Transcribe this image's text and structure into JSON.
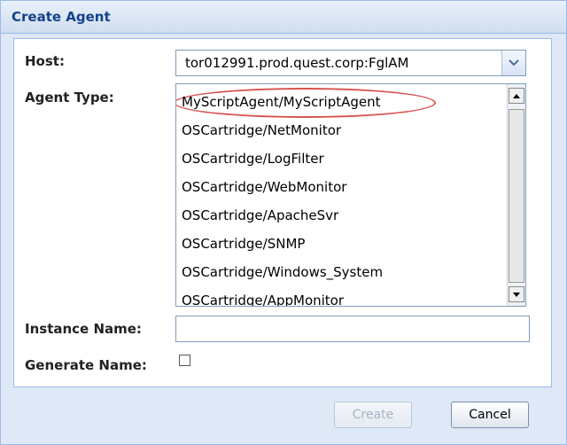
{
  "dialog": {
    "title": "Create Agent"
  },
  "form": {
    "host_label": "Host:",
    "host_value": "tor012991.prod.quest.corp:FglAM",
    "agent_type_label": "Agent Type:",
    "agent_types": [
      "MyScriptAgent/MyScriptAgent",
      "OSCartridge/NetMonitor",
      "OSCartridge/LogFilter",
      "OSCartridge/WebMonitor",
      "OSCartridge/ApacheSvr",
      "OSCartridge/SNMP",
      "OSCartridge/Windows_System",
      "OSCartridge/AppMonitor"
    ],
    "instance_name_label": "Instance Name:",
    "instance_name_value": "",
    "generate_name_label": "Generate Name:"
  },
  "buttons": {
    "create": "Create",
    "cancel": "Cancel"
  },
  "colors": {
    "accent": "#15428b",
    "highlight": "#d9534f"
  }
}
